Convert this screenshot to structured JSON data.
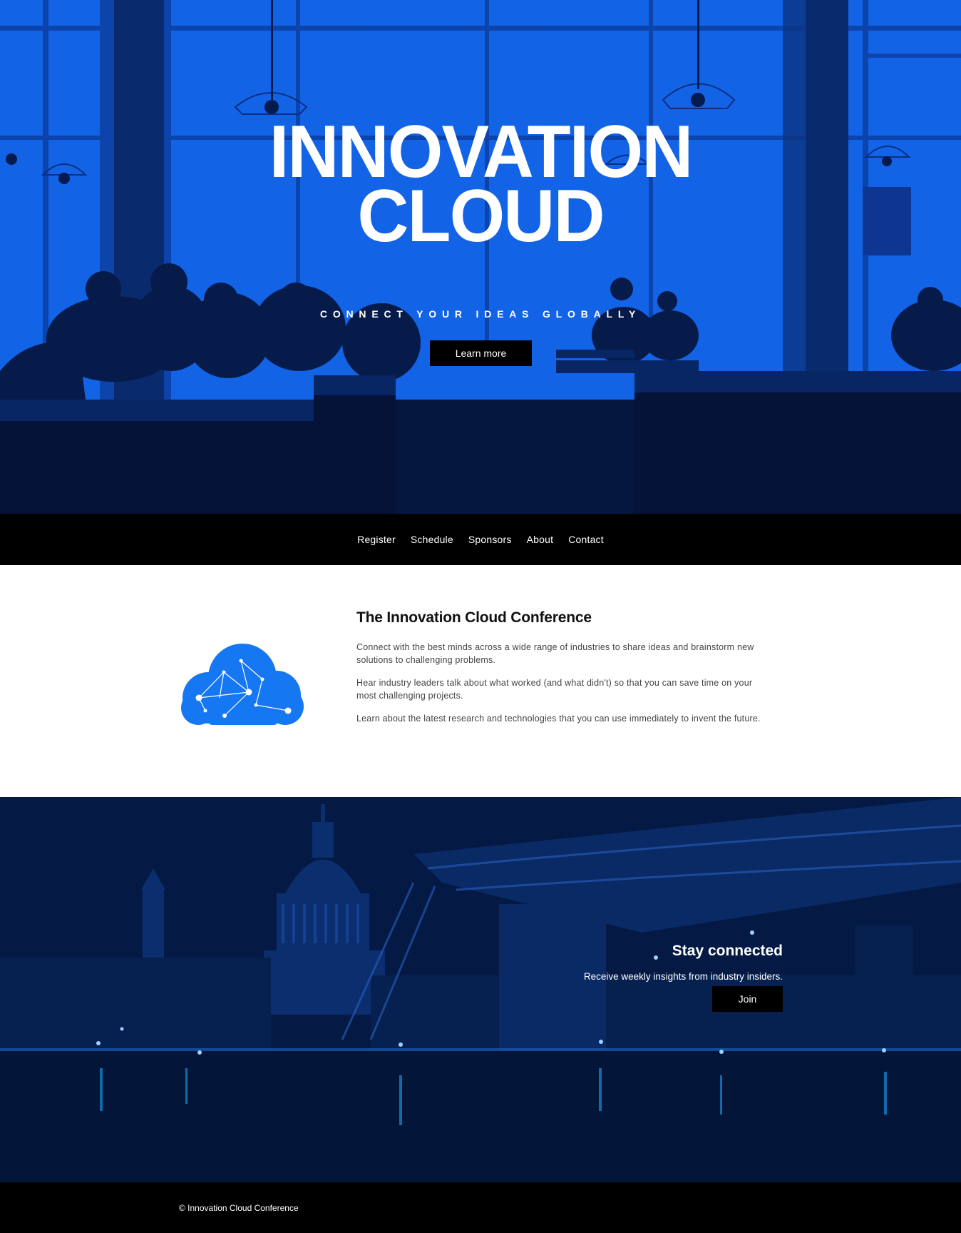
{
  "hero": {
    "title_line1": "INNOVATION",
    "title_line2": "CLOUD",
    "tagline": "CONNECT YOUR IDEAS GLOBALLY",
    "cta_label": "Learn more"
  },
  "nav": {
    "items": [
      {
        "label": "Register"
      },
      {
        "label": "Schedule"
      },
      {
        "label": "Sponsors"
      },
      {
        "label": "About"
      },
      {
        "label": "Contact"
      }
    ]
  },
  "about": {
    "logo_icon": "cloud-network-icon",
    "heading": "The Innovation Cloud Conference",
    "paragraphs": [
      "Connect with the best minds across a wide range of industries to share ideas and brainstorm new solutions to challenging problems.",
      "Hear industry leaders talk about what worked (and what didn't) so that you can save time on your most challenging projects.",
      "Learn about the latest research and technologies that you can use immediately to invent the future."
    ]
  },
  "connect": {
    "heading": "Stay connected",
    "text": "Receive weekly insights from industry insiders.",
    "button_label": "Join"
  },
  "footer": {
    "copyright": "© Innovation Cloud Conference"
  },
  "colors": {
    "accent": "#1263e6",
    "cloud_blue": "#1677f2",
    "dark_navy": "#041a44",
    "black": "#000000"
  }
}
